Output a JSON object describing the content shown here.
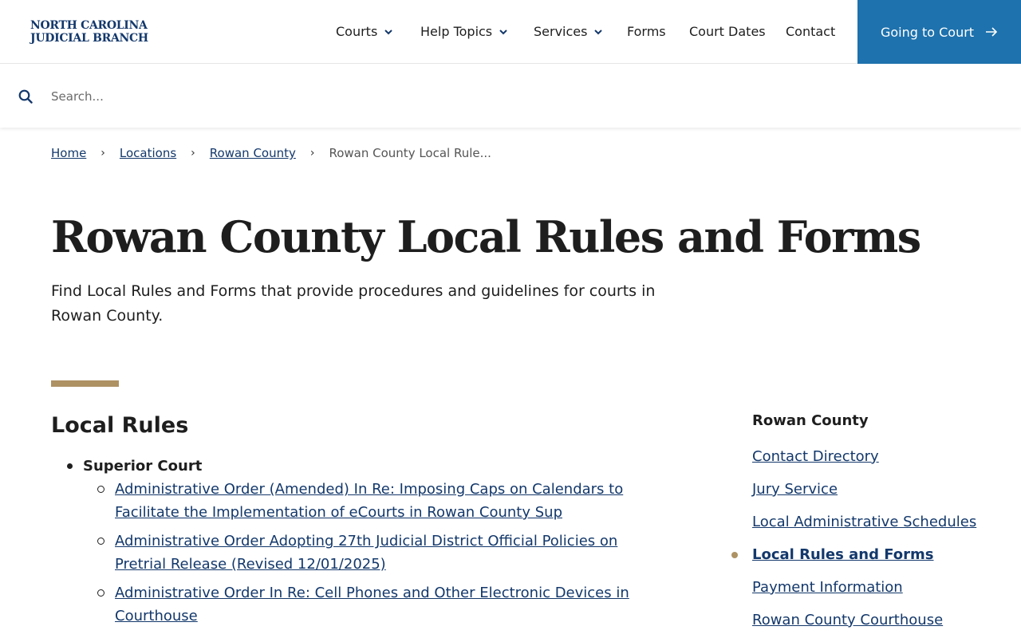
{
  "header": {
    "logo_line1": "NORTH CAROLINA",
    "logo_line2": "JUDICIAL BRANCH",
    "nav": [
      {
        "label": "Courts",
        "has_dropdown": true
      },
      {
        "label": "Help Topics",
        "has_dropdown": true
      },
      {
        "label": "Services",
        "has_dropdown": true
      },
      {
        "label": "Forms",
        "has_dropdown": false
      },
      {
        "label": "Court Dates",
        "has_dropdown": false
      },
      {
        "label": "Contact",
        "has_dropdown": false
      }
    ],
    "cta_label": "Going to Court",
    "cta_icon": "arrow-right-icon"
  },
  "search": {
    "placeholder": "Search...",
    "value": "",
    "icon": "search-icon"
  },
  "breadcrumb": {
    "items": [
      "Home",
      "Locations",
      "Rowan County"
    ],
    "current": "Rowan County Local Rule..."
  },
  "page": {
    "title": "Rowan County Local Rules and Forms",
    "intro": "Find Local Rules and Forms that provide procedures and guidelines for courts in Rowan County."
  },
  "local_rules": {
    "heading": "Local Rules",
    "groups": [
      {
        "label": "Superior Court",
        "links": [
          "Administrative Order (Amended) In Re: Imposing Caps on Calendars to Facilitate the Implementation of eCourts in Rowan County Sup",
          "Administrative Order Adopting 27th Judicial District Official Policies on Pretrial Release (Revised 12/01/2025)",
          "Administrative Order In Re: Cell Phones and Other Electronic Devices in Courthouse"
        ]
      }
    ]
  },
  "sidebar": {
    "title": "Rowan County",
    "items": [
      {
        "label": "Contact Directory",
        "active": false
      },
      {
        "label": "Jury Service",
        "active": false
      },
      {
        "label": "Local Administrative Schedules",
        "active": false
      },
      {
        "label": "Local Rules and Forms",
        "active": true
      },
      {
        "label": "Payment Information",
        "active": false
      },
      {
        "label": "Rowan County Courthouse",
        "active": false
      }
    ]
  },
  "colors": {
    "brand_navy": "#13386b",
    "cta_blue": "#1e72ad",
    "accent_gold": "#ae9264",
    "text": "#1e1e1e"
  }
}
